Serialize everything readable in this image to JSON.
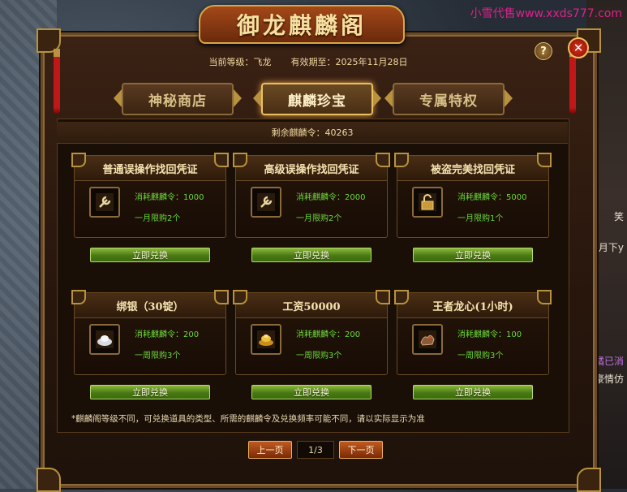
{
  "watermark": "小雪代售www.xxds777.com",
  "side_texts": [
    "笑",
    "冂月下y",
    "橘已消",
    "豪情仿"
  ],
  "window": {
    "title": "御龙麒麟阁",
    "help_label": "?",
    "close_label": "✕"
  },
  "info": {
    "level_text": "当前等级：飞龙",
    "expiry_text": "有效期至：2025年11月28日"
  },
  "tabs": [
    {
      "label": "神秘商店",
      "active": false
    },
    {
      "label": "麒麟珍宝",
      "active": true
    },
    {
      "label": "专属特权",
      "active": false
    }
  ],
  "balance_text": "剩余麒麟令：40263",
  "items": [
    {
      "name": "普通误操作找回凭证",
      "cost": "消耗麒麟令：1000",
      "limit": "一月限购2个",
      "icon": "wrench-icon",
      "button": "立即兑换"
    },
    {
      "name": "高级误操作找回凭证",
      "cost": "消耗麒麟令：2000",
      "limit": "一月限购2个",
      "icon": "wrench-icon",
      "button": "立即兑换"
    },
    {
      "name": "被盗完美找回凭证",
      "cost": "消耗麒麟令：5000",
      "limit": "一月限购1个",
      "icon": "lock-icon",
      "button": "立即兑换"
    },
    {
      "name": "绑银（30锭）",
      "cost": "消耗麒麟令：200",
      "limit": "一周限购3个",
      "icon": "silver-ingot-icon",
      "button": "立即兑换"
    },
    {
      "name": "工资50000",
      "cost": "消耗麒麟令：200",
      "limit": "一周限购3个",
      "icon": "gold-ingot-icon",
      "button": "立即兑换"
    },
    {
      "name": "王者龙心(1小时)",
      "cost": "消耗麒麟令：100",
      "limit": "一周限购3个",
      "icon": "dragon-heart-icon",
      "button": "立即兑换"
    }
  ],
  "footnote": "*麒麟阁等级不同，可兑换道具的类型、所需的麒麟令及兑换频率可能不同，请以实际显示为准",
  "pager": {
    "prev_label": "上一页",
    "page_indicator": "1/3",
    "next_label": "下一页"
  }
}
